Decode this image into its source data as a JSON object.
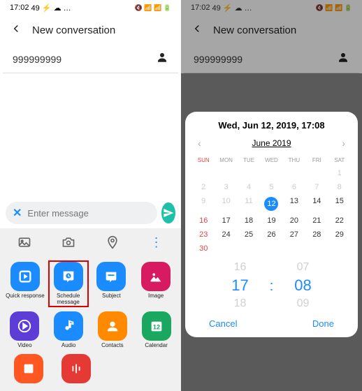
{
  "status": {
    "time": "17:02",
    "left_icons": "49 ⚡ ☁ …",
    "right_icons": "🔇 📶 📶 🔋"
  },
  "header": {
    "title": "New conversation"
  },
  "recipient": "999999999",
  "input": {
    "placeholder": "Enter message"
  },
  "apps": {
    "quick_response": "Quick response",
    "schedule": "Schedule message",
    "subject": "Subject",
    "image": "Image",
    "video": "Video",
    "audio": "Audio",
    "contacts": "Contacts",
    "calendar": "Calendar"
  },
  "dialog": {
    "date_header": "Wed, Jun 12, 2019, 17:08",
    "month": "June 2019",
    "dow": [
      "SUN",
      "MON",
      "TUE",
      "WED",
      "THU",
      "FRI",
      "SAT"
    ],
    "rows": [
      [
        "",
        "",
        "",
        "",
        "",
        "",
        "1"
      ],
      [
        "2",
        "3",
        "4",
        "5",
        "6",
        "7",
        "8"
      ],
      [
        "9",
        "10",
        "11",
        "12",
        "13",
        "14",
        "15"
      ],
      [
        "16",
        "17",
        "18",
        "19",
        "20",
        "21",
        "22"
      ],
      [
        "23",
        "24",
        "25",
        "26",
        "27",
        "28",
        "29"
      ],
      [
        "30",
        "",
        "",
        "",
        "",
        "",
        ""
      ]
    ],
    "time": {
      "hour_prev": "16",
      "hour": "17",
      "hour_next": "18",
      "min_prev": "07",
      "min": "08",
      "min_next": "09"
    },
    "cancel": "Cancel",
    "done": "Done"
  }
}
